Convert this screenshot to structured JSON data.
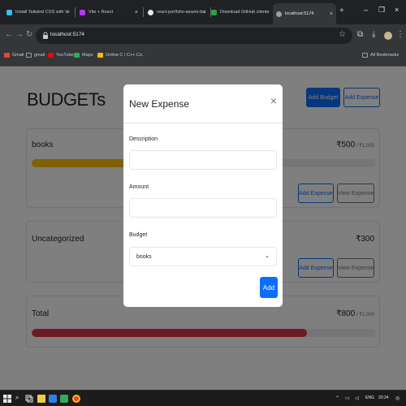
{
  "browser": {
    "tabs": [
      {
        "title": "Install Tailwind CSS with V",
        "color": "#38bdf8"
      },
      {
        "title": "Vite + React",
        "color": "#bd34fe"
      },
      {
        "title": "react-portfolio-assets-bu",
        "color": "#e8eaed"
      },
      {
        "title": "Download GitHub client",
        "color": "#2ea043"
      },
      {
        "title": "localhost:5174",
        "color": "#9aa0a6"
      }
    ],
    "active_tab": 4,
    "url": "localhost:5174",
    "bookmarks": [
      {
        "label": "Gmail",
        "color": "#ea4335"
      },
      {
        "label": "gmail",
        "color": "#9aa0a6"
      },
      {
        "label": "YouTube",
        "color": "#ff0000"
      },
      {
        "label": "Maps",
        "color": "#34a853"
      },
      {
        "label": "Online C / C++ Co..",
        "color": "#fbbc04"
      }
    ],
    "all_bookmarks": "All Bookmarks"
  },
  "page": {
    "title": "BUDGETs",
    "add_budget_label": "Add Budget",
    "add_expense_label": "Add Expense",
    "cards": [
      {
        "name": "books",
        "amount": "₹500",
        "max": " / ₹1,000",
        "progress": 0.5,
        "bar_color": "#ffc107",
        "add_label": "Add Expense",
        "view_label": "View Expense"
      },
      {
        "name": "Uncategorized",
        "amount": "₹300",
        "add_label": "Add Expense",
        "view_label": "View Expense"
      },
      {
        "name": "Total",
        "amount": "₹800",
        "max": " / ₹1,000",
        "progress": 0.8,
        "bar_color": "#dc3545"
      }
    ]
  },
  "modal": {
    "title": "New Expense",
    "close_glyph": "×",
    "description_label": "Description",
    "description_value": "",
    "amount_label": "Amount",
    "amount_value": "",
    "budget_label": "Budget",
    "budget_selected": "books",
    "submit_label": "Add"
  },
  "taskbar": {
    "time": "20:24",
    "lang": "ENG"
  }
}
